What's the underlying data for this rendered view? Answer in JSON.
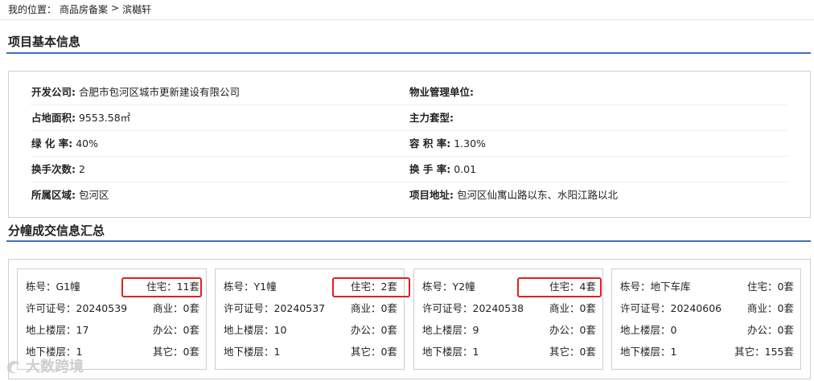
{
  "breadcrumb": {
    "prefix": "我的位置：",
    "items": [
      "商品房备案",
      "滨樾轩"
    ],
    "separator": ">"
  },
  "sections": {
    "basic_info": "项目基本信息",
    "building_summary": "分幢成交信息汇总"
  },
  "project_info": [
    {
      "left_label": "开发公司:",
      "left_value": "合肥市包河区城市更新建设有限公司",
      "right_label": "物业管理单位:",
      "right_value": ""
    },
    {
      "left_label": "占地面积:",
      "left_value": "9553.58㎡",
      "right_label": "主力套型:",
      "right_value": ""
    },
    {
      "left_label": "绿 化 率:",
      "left_value": "40%",
      "right_label": "容 积 率:",
      "right_value": "1.30%"
    },
    {
      "left_label": "换手次数:",
      "left_value": "2",
      "right_label": "换 手 率:",
      "right_value": "0.01"
    },
    {
      "left_label": "所属区域:",
      "left_value": "包河区",
      "right_label": "项目地址:",
      "right_value": "包河区仙寓山路以东、水阳江路以北"
    }
  ],
  "buildings": [
    {
      "building": "栋号：G1幢",
      "residential": "住宅：11套",
      "permit": "许可证号：20240539",
      "commercial": "商业：0套",
      "above": "地上楼层：17",
      "office": "办公：0套",
      "below": "地下楼层：1",
      "other": "其它：0套"
    },
    {
      "building": "栋号：Y1幢",
      "residential": "住宅：2套",
      "permit": "许可证号：20240537",
      "commercial": "商业：0套",
      "above": "地上楼层：10",
      "office": "办公：0套",
      "below": "地下楼层：1",
      "other": "其它：0套"
    },
    {
      "building": "栋号：Y2幢",
      "residential": "住宅：4套",
      "permit": "许可证号：20240538",
      "commercial": "商业：0套",
      "above": "地上楼层：9",
      "office": "办公：0套",
      "below": "地下楼层：1",
      "other": "其它：0套"
    },
    {
      "building": "栋号：地下车库",
      "residential": "住宅：0套",
      "permit": "许可证号：20240606",
      "commercial": "商业：0套",
      "above": "地上楼层：0",
      "office": "办公：0套",
      "below": "地下楼层：1",
      "other": "其它：155套"
    }
  ],
  "watermark": "大数跨境",
  "colors": {
    "section_rule": "#3f6fc1",
    "highlight": "#e02020",
    "border": "#cfcfcf"
  }
}
